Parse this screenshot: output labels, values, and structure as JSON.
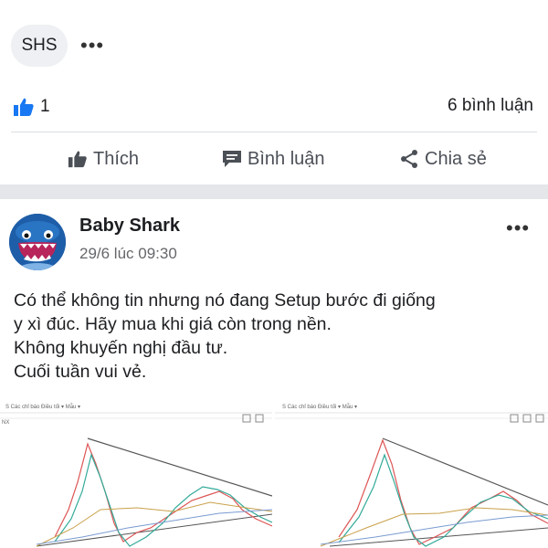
{
  "top_post": {
    "tag": "SHS",
    "more_label": "•••",
    "like_count": "1",
    "comment_count": "6 bình luận",
    "actions": {
      "like": "Thích",
      "comment": "Bình luận",
      "share": "Chia sẻ"
    }
  },
  "post": {
    "author": "Baby Shark",
    "timestamp": "29/6 lúc 09:30",
    "more_label": "•••",
    "lines": [
      "Có thể không tin nhưng nó đang Setup bước đi giống",
      "y xì đúc. Hãy mua khi giá còn trong nền.",
      "Không khuyến nghị đầu tư.",
      "Cuối tuần vui vẻ."
    ]
  },
  "images": {
    "left_ticker": "NX",
    "left_toolbar": "S  Các chỉ báo   Điều tối ▾   Mẫu ▾",
    "right_toolbar": "S  Các chỉ báo   Điều tối ▾   Mẫu ▾"
  },
  "colors": {
    "like_blue": "#1877f2",
    "band": "#e4e6e9",
    "avatar_blue": "#1e5ea8"
  }
}
